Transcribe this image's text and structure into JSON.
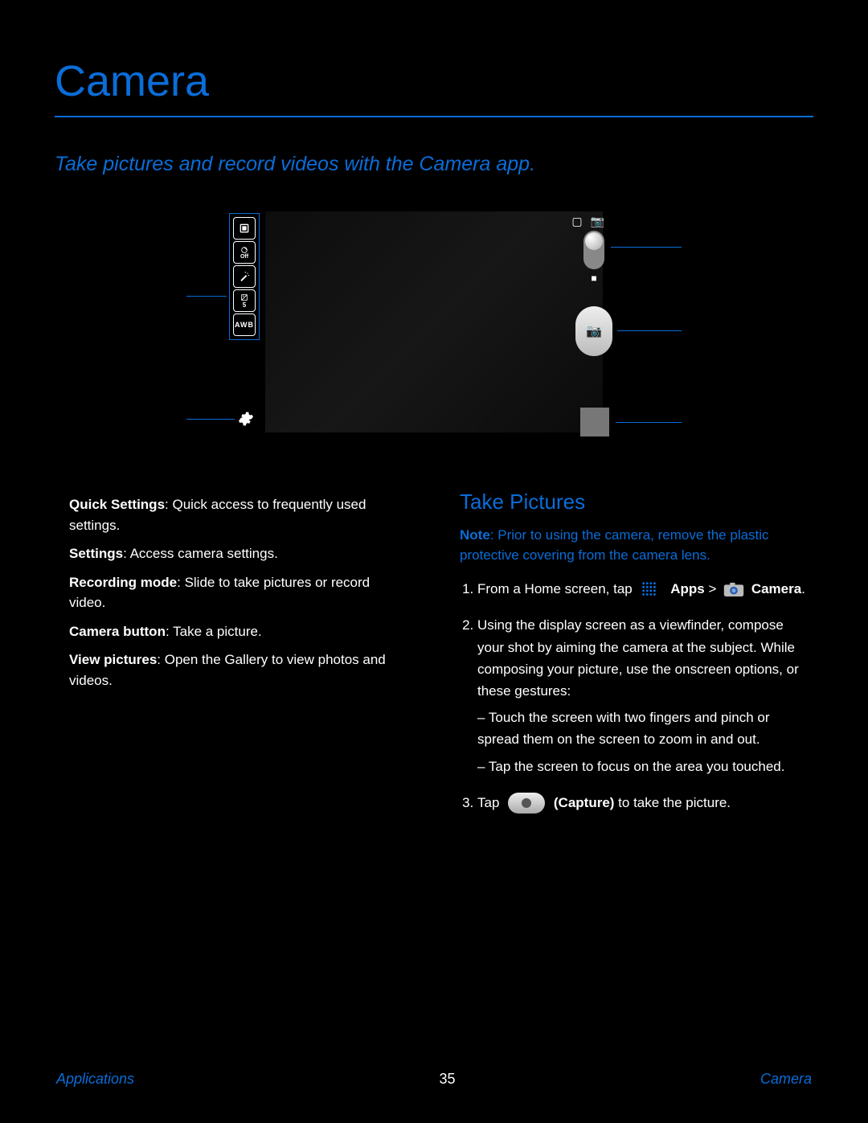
{
  "page": {
    "title": "Camera",
    "subtitle": "Take pictures and record videos with the Camera app."
  },
  "illustration": {
    "quick_settings": [
      "storage",
      "timer-off",
      "effects",
      "exposure",
      "awb"
    ],
    "labels": {
      "quick_settings": "Quick Settings",
      "settings": "Settings",
      "recording_mode": "Recording mode",
      "camera_button": "Camera button",
      "view_pictures": "View pictures"
    }
  },
  "left_column": {
    "bullets": [
      {
        "term": "Quick Settings",
        "desc": ": Quick access to frequently used settings."
      },
      {
        "term": "Settings",
        "desc": ": Access camera settings."
      },
      {
        "term": "Recording mode",
        "desc": ": Slide to take pictures or record video."
      },
      {
        "term": "Camera button",
        "desc": ": Take a picture."
      },
      {
        "term": "View pictures",
        "desc": ": Open the Gallery to view photos and videos."
      }
    ]
  },
  "right_column": {
    "heading": "Take Pictures",
    "note_label": "Note",
    "note_text": ": Prior to using the camera, remove the plastic protective covering from the camera lens.",
    "steps": [
      {
        "pre": "From a Home screen, tap ",
        "apps_label": "Apps",
        "mid": " > ",
        "camera_label": "Camera",
        "post": "."
      },
      {
        "text": "Using the display screen as a viewfinder, compose your shot by aiming the camera at the subject. While composing your picture, use the onscreen options, or these gestures:",
        "sub_bullets": [
          "Touch the screen with two fingers and pinch or spread them on the screen to zoom in and out.",
          "Tap the screen to focus on the area you touched."
        ]
      },
      {
        "pre": "Tap ",
        "capture_label": "(Capture)",
        "post": " to take the picture."
      }
    ]
  },
  "footer": {
    "left": "Applications",
    "page_number": "35",
    "right": "Camera"
  }
}
